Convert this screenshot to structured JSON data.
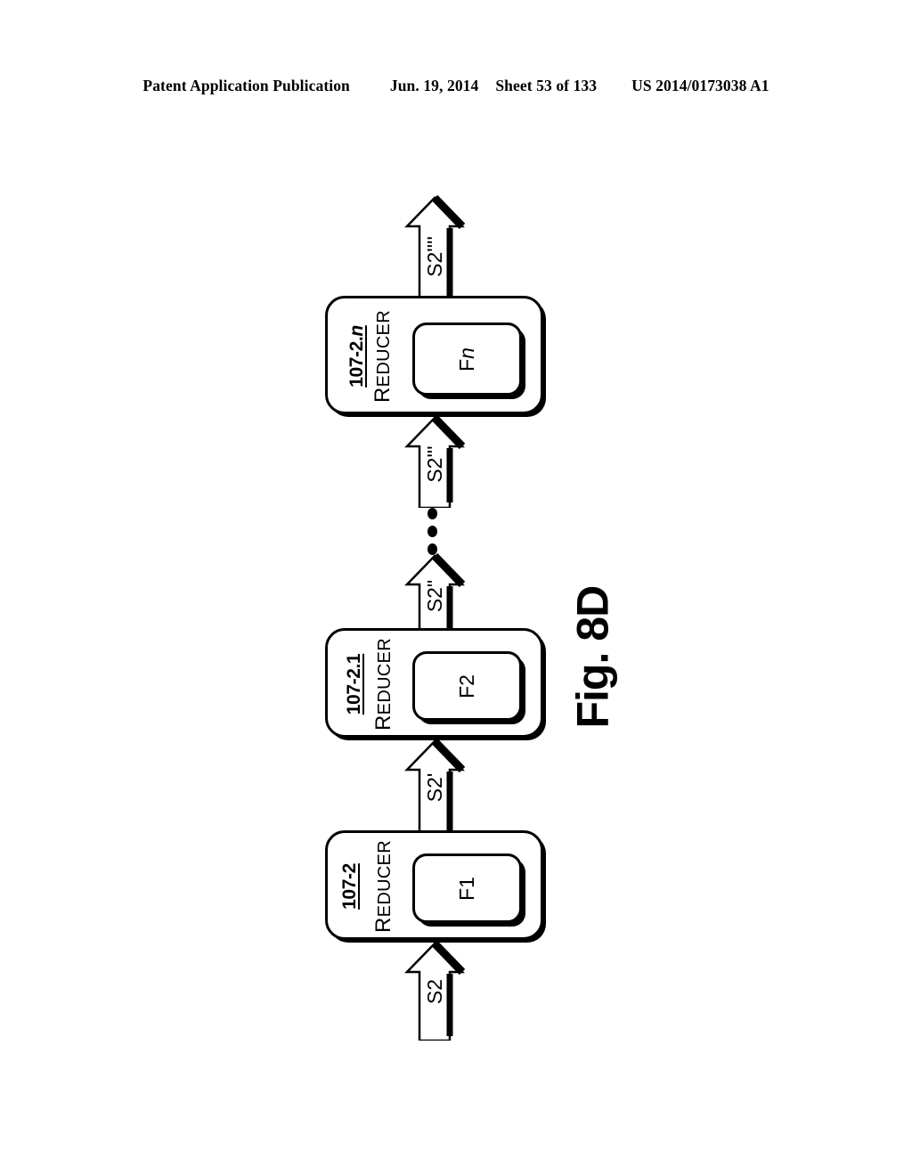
{
  "header": {
    "publication": "Patent Application Publication",
    "date": "Jun. 19, 2014",
    "sheet": "Sheet 53 of 133",
    "patent_number": "US 2014/0173038 A1"
  },
  "figure": {
    "caption": "Fig. 8D",
    "orientation": "rotated-90-ccw",
    "ellipsis": "⋮"
  },
  "diagram": {
    "type": "pipeline-flow",
    "blocks": [
      {
        "id": "107-2",
        "id_italic_suffix": "",
        "kind_first": "R",
        "kind_rest": "EDUCER",
        "kind_full": "REDUCER",
        "fn_base": "F",
        "fn_suffix": "1",
        "fn_suffix_italic": false,
        "fn_full": "F1"
      },
      {
        "id": "107-2.1",
        "id_italic_suffix": "",
        "kind_first": "R",
        "kind_rest": "EDUCER",
        "kind_full": "REDUCER",
        "fn_base": "F",
        "fn_suffix": "2",
        "fn_suffix_italic": false,
        "fn_full": "F2"
      },
      {
        "id": "107-2.",
        "id_italic_suffix": "n",
        "kind_first": "R",
        "kind_rest": "EDUCER",
        "kind_full": "REDUCER",
        "fn_base": "F",
        "fn_suffix": "n",
        "fn_suffix_italic": true,
        "fn_full": "Fn"
      }
    ],
    "arrows": [
      {
        "label": "S2",
        "position": "input-to-107-2"
      },
      {
        "label": "S2'",
        "position": "107-2-to-107-2.1"
      },
      {
        "label": "S2\"",
        "position": "107-2.1-output"
      },
      {
        "label": "S2'''",
        "position": "input-to-107-2.n"
      },
      {
        "label": "S2''''",
        "position": "107-2.n-output"
      }
    ]
  },
  "colors": {
    "ink": "#000000",
    "paper": "#ffffff"
  }
}
